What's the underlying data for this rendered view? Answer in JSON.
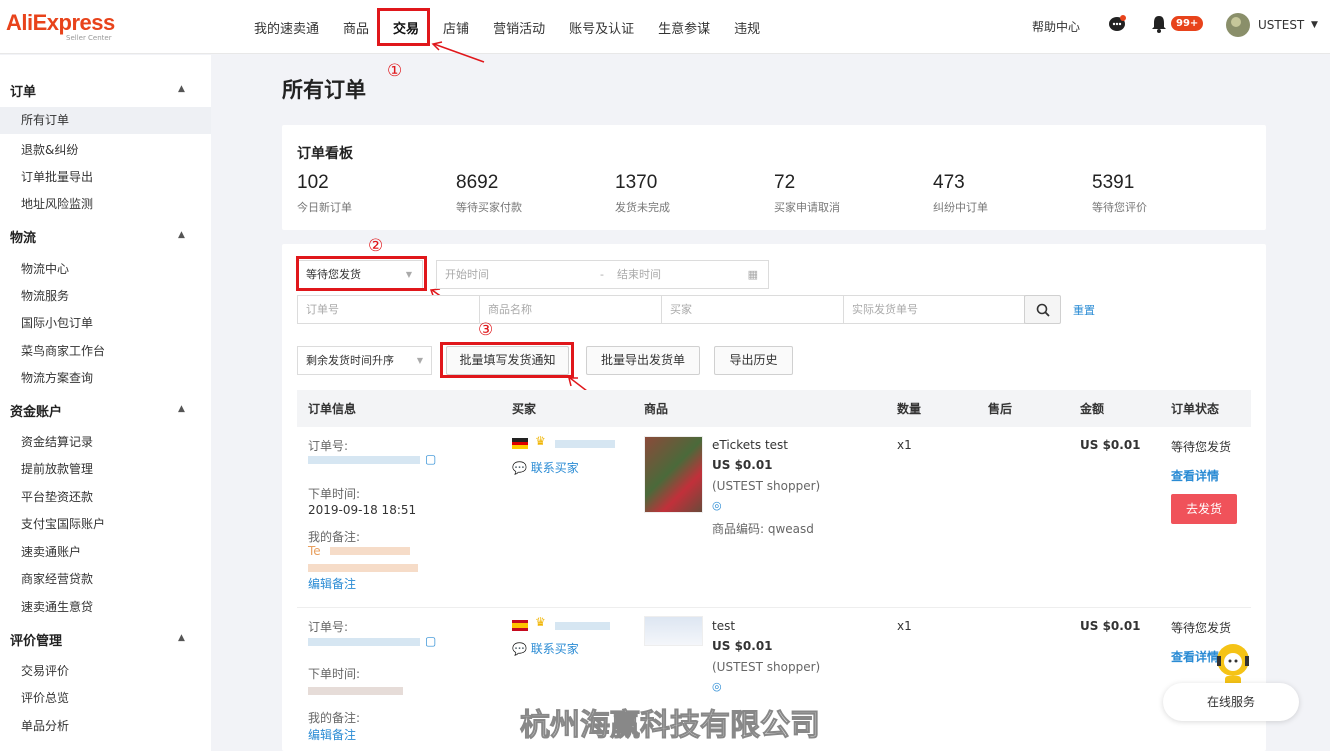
{
  "header": {
    "logo": "AliExpress",
    "logo_sub": "Seller Center",
    "nav": [
      "我的速卖通",
      "商品",
      "交易",
      "店铺",
      "营销活动",
      "账号及认证",
      "生意参谋",
      "违规"
    ],
    "help": "帮助中心",
    "notify_badge": "99+",
    "user": "USTEST"
  },
  "annotations": [
    "①",
    "②",
    "③"
  ],
  "sidebar": {
    "sections": [
      {
        "title": "订单",
        "items": [
          "所有订单",
          "退款&纠纷",
          "订单批量导出",
          "地址风险监测"
        ]
      },
      {
        "title": "物流",
        "items": [
          "物流中心",
          "物流服务",
          "国际小包订单",
          "菜鸟商家工作台",
          "物流方案查询"
        ]
      },
      {
        "title": "资金账户",
        "items": [
          "资金结算记录",
          "提前放款管理",
          "平台垫资还款",
          "支付宝国际账户",
          "速卖通账户",
          "商家经营贷款",
          "速卖通生意贷"
        ]
      },
      {
        "title": "评价管理",
        "items": [
          "交易评价",
          "评价总览",
          "单品分析"
        ]
      }
    ]
  },
  "page_title": "所有订单",
  "dashboard": {
    "title": "订单看板",
    "stats": [
      {
        "value": "102",
        "label": "今日新订单"
      },
      {
        "value": "8692",
        "label": "等待买家付款"
      },
      {
        "value": "1370",
        "label": "发货未完成"
      },
      {
        "value": "72",
        "label": "买家申请取消"
      },
      {
        "value": "473",
        "label": "纠纷中订单"
      },
      {
        "value": "5391",
        "label": "等待您评价"
      }
    ]
  },
  "filters": {
    "status": "等待您发货",
    "start": "开始时间",
    "dash": "-",
    "end": "结束时间",
    "order_no": "订单号",
    "product": "商品名称",
    "buyer": "买家",
    "tracking": "实际发货单号",
    "reset": "重置",
    "sort": "剩余发货时间升序",
    "batch_notice": "批量填写发货通知",
    "batch_export": "批量导出发货单",
    "export_history": "导出历史"
  },
  "table": {
    "headers": [
      "订单信息",
      "买家",
      "商品",
      "数量",
      "售后",
      "金额",
      "订单状态"
    ],
    "rows": [
      {
        "order_label": "订单号:",
        "time_label": "下单时间:",
        "time": "2019-09-18 18:51",
        "note_label": "我的备注:",
        "note": "Te",
        "edit": "编辑备注",
        "contact": "联系买家",
        "product": "eTickets test",
        "price": "US $0.01",
        "shop": "(USTEST shopper)",
        "code": "商品编码: qweasd",
        "qty": "x1",
        "amount": "US $0.01",
        "status": "等待您发货",
        "detail": "查看详情",
        "ship": "去发货"
      },
      {
        "order_label": "订单号:",
        "time_label": "下单时间:",
        "note_label": "我的备注:",
        "edit": "编辑备注",
        "contact": "联系买家",
        "product": "test",
        "price": "US $0.01",
        "shop": "(USTEST shopper)",
        "qty": "x1",
        "amount": "US $0.01",
        "status": "等待您发货",
        "detail": "查看详情"
      }
    ]
  },
  "service": "在线服务",
  "watermark": "杭州海赢科技有限公司",
  "colors": {
    "brand": "#e8431b",
    "annotation_red": "#e0171b",
    "link": "#2a8bd4",
    "ship_button": "#f0525a"
  }
}
